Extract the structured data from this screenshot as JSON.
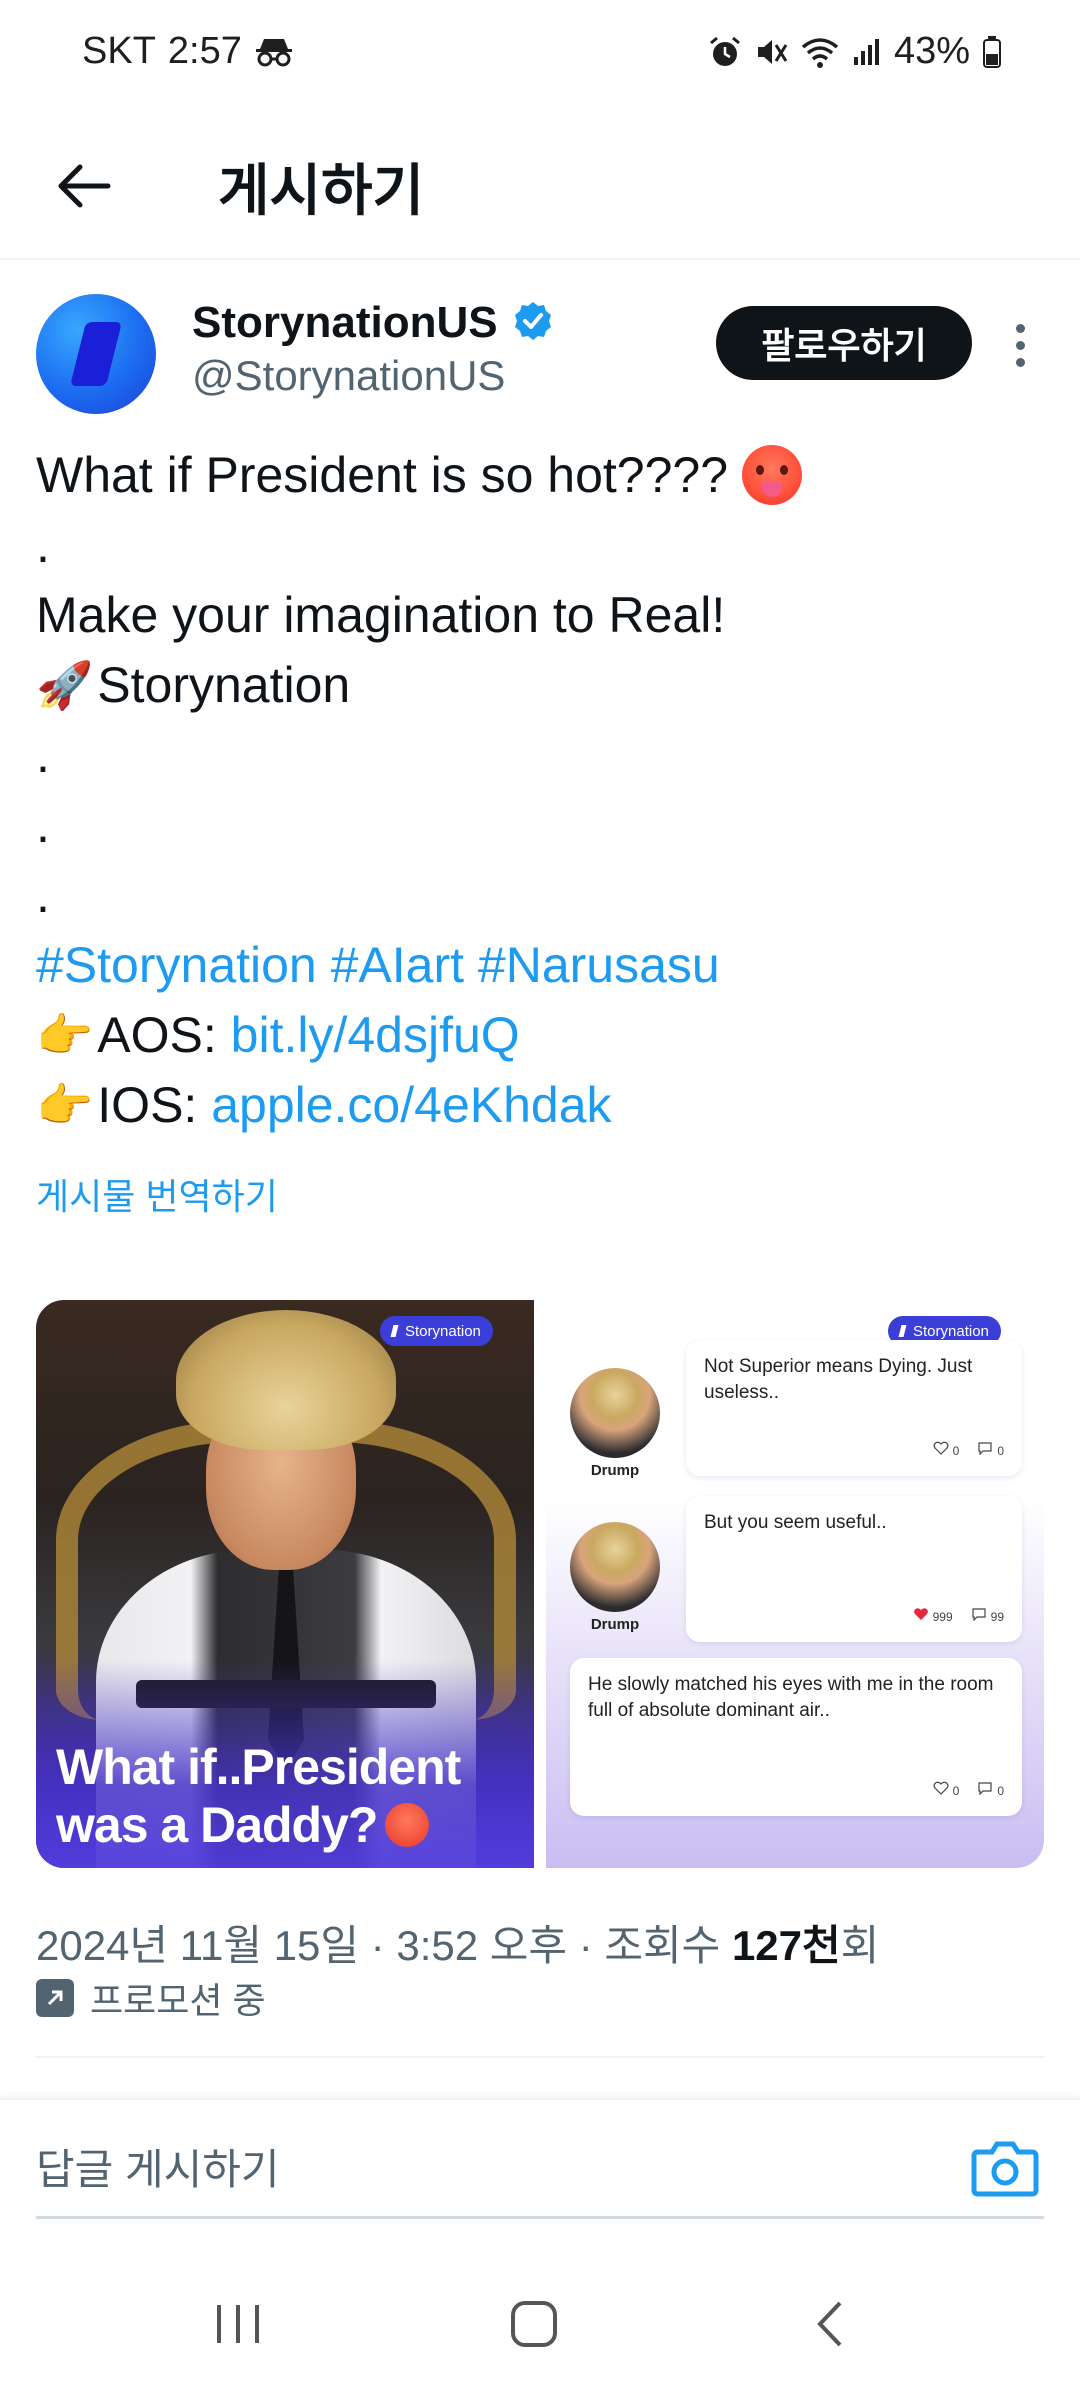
{
  "status_bar": {
    "carrier": "SKT",
    "time": "2:57",
    "battery": "43%"
  },
  "header": {
    "title": "게시하기"
  },
  "author": {
    "display_name": "StorynationUS",
    "handle": "@StorynationUS",
    "verified": true,
    "follow_label": "팔로우하기"
  },
  "tweet": {
    "line1": "What if President is so hot????",
    "dot": ".",
    "line3": "Make your imagination to Real!",
    "line4": "Storynation",
    "hashtags": "#Storynation #AIart #Narusasu",
    "aos_label": "AOS: ",
    "aos_link": "bit.ly/4dsjfuQ",
    "ios_label": "IOS: ",
    "ios_link": "apple.co/4eKhdak",
    "translate_label": "게시물 번역하기"
  },
  "media": {
    "left": {
      "badge": "Storynation",
      "caption_line1": "What if..President",
      "caption_line2": "was a Daddy?"
    },
    "right": {
      "badge": "Storynation",
      "messages": [
        {
          "name": "Drump",
          "text": "Not Superior means Dying. Just useless..",
          "likes": "0",
          "comments": "0"
        },
        {
          "name": "Drump",
          "text": "But you seem useful..",
          "likes": "999",
          "comments": "99"
        },
        {
          "name": "",
          "text": "He slowly matched his eyes with me in the room full of absolute dominant air..",
          "likes": "0",
          "comments": "0"
        }
      ]
    }
  },
  "meta": {
    "date": "2024년 11월 15일 · 3:52 오후 · 조회수 ",
    "views": "127천",
    "views_suffix": "회",
    "promo": "프로모션 중"
  },
  "reply": {
    "placeholder": "답글 게시하기"
  },
  "colors": {
    "link": "#1d9bf0",
    "verified": "#1d9bf0",
    "follow_bg": "#0f1419",
    "badge": "#3b3fd8"
  }
}
